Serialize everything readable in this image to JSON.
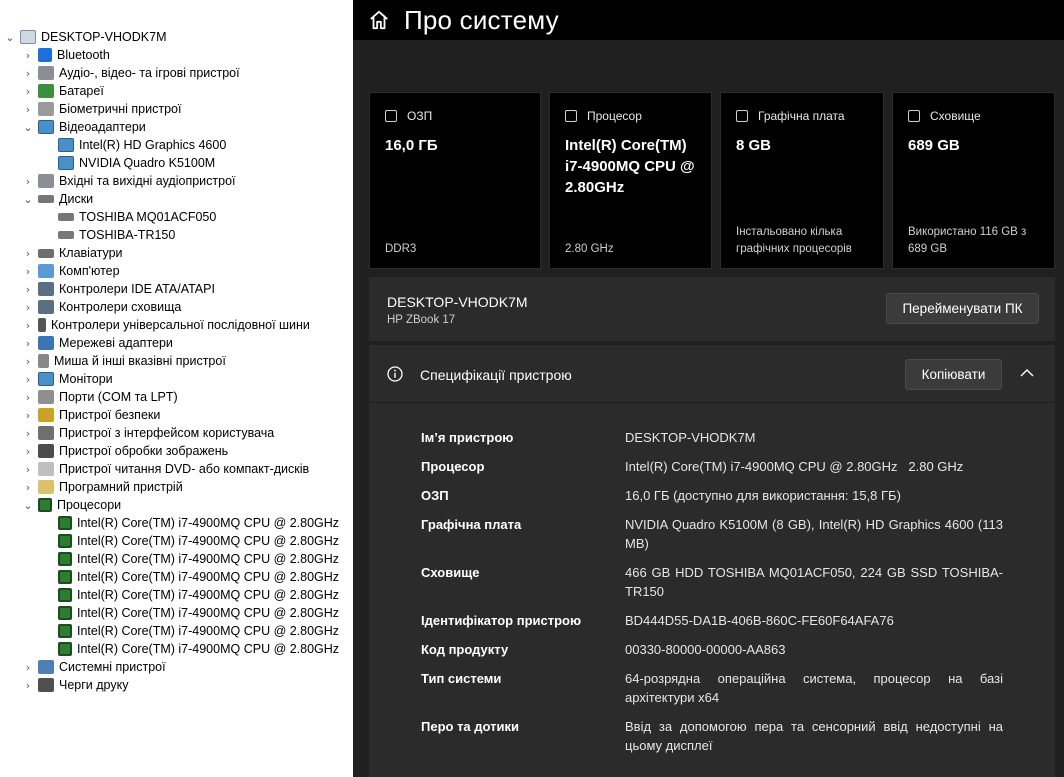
{
  "device_manager": {
    "root": "DESKTOP-VHODK7M",
    "categories": {
      "bluetooth": "Bluetooth",
      "audio": "Аудіо-, відео- та ігрові пристрої",
      "batteries": "Батареї",
      "biometric": "Біометричні пристрої",
      "display": "Відеоадаптери",
      "gpu1": "Intel(R) HD Graphics 4600",
      "gpu2": "NVIDIA Quadro K5100M",
      "audio_io": "Вхідні та вихідні аудіопристрої",
      "disks": "Диски",
      "disk1": "TOSHIBA MQ01ACF050",
      "disk2": "TOSHIBA-TR150",
      "keyboards": "Клавіатури",
      "computer": "Комп'ютер",
      "ide": "Контролери IDE ATA/ATAPI",
      "storage": "Контролери сховища",
      "usb": "Контролери універсальної послідовної шини",
      "network": "Мережеві адаптери",
      "mice": "Миша й інші вказівні пристрої",
      "monitors": "Монітори",
      "ports": "Порти (COM та LPT)",
      "security": "Пристрої безпеки",
      "hid": "Пристрої з інтерфейсом користувача",
      "imaging": "Пристрої обробки зображень",
      "dvd": "Пристрої читання DVD- або компакт-дисків",
      "software": "Програмний пристрій",
      "processors": "Процесори",
      "cpu_item": "Intel(R) Core(TM) i7-4900MQ CPU @ 2.80GHz",
      "system": "Системні пристрої",
      "print": "Черги друку"
    }
  },
  "settings": {
    "title": "Про систему",
    "cards": {
      "ram": {
        "label": "ОЗП",
        "value": "16,0 ГБ",
        "foot": "DDR3"
      },
      "cpu": {
        "label": "Процесор",
        "value": "Intel(R) Core(TM) i7-4900MQ CPU @ 2.80GHz",
        "foot": "2.80 GHz"
      },
      "gpu": {
        "label": "Графічна плата",
        "value": "8 GB",
        "foot": "Інстальовано кілька графічних процесорів"
      },
      "storage": {
        "label": "Сховище",
        "value": "689 GB",
        "foot": "Використано 116 GB з 689 GB"
      }
    },
    "device": {
      "name": "DESKTOP-VHODK7M",
      "model": "HP ZBook 17",
      "rename_label": "Перейменувати ПК"
    },
    "specs": {
      "title": "Специфікації пристрою",
      "copy_label": "Копіювати",
      "rows": {
        "name": {
          "label": "Ім’я пристрою",
          "value": "DESKTOP-VHODK7M"
        },
        "cpu": {
          "label": "Процесор",
          "value": "Intel(R) Core(TM) i7-4900MQ CPU @ 2.80GHz   2.80 GHz"
        },
        "ram": {
          "label": "ОЗП",
          "value": "16,0 ГБ (доступно для використання: 15,8 ГБ)"
        },
        "gpu": {
          "label": "Графічна плата",
          "value": "NVIDIA Quadro K5100M (8 GB), Intel(R) HD Graphics 4600 (113 MB)"
        },
        "storage": {
          "label": "Сховище",
          "value": "466 GB HDD TOSHIBA MQ01ACF050, 224 GB SSD TOSHIBA-TR150"
        },
        "device_id": {
          "label": "Ідентифікатор пристрою",
          "value": "BD444D55-DA1B-406B-860C-FE60F64AFA76"
        },
        "product_id": {
          "label": "Код продукту",
          "value": "00330-80000-00000-AA863"
        },
        "system_type": {
          "label": "Тип системи",
          "value": "64-розрядна операційна система, процесор на базі архітектури x64"
        },
        "pen": {
          "label": "Перо та дотики",
          "value": "Ввід за допомогою пера та сенсорний ввід недоступні на цьому дисплеї"
        }
      }
    }
  }
}
